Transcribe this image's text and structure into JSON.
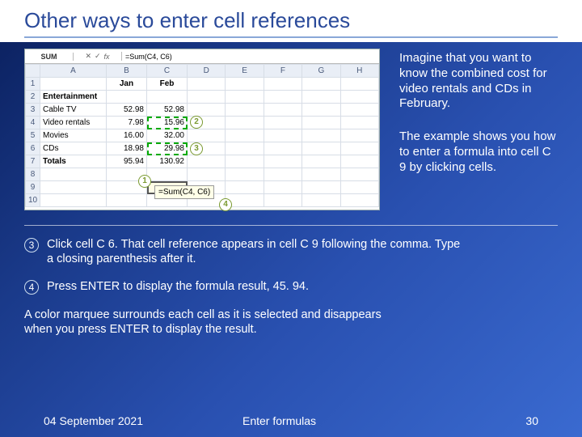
{
  "title": "Other ways to enter cell references",
  "excel": {
    "namebox": "SUM",
    "fx_icons": {
      "cancel": "✕",
      "confirm": "✓",
      "fx": "fx"
    },
    "formula": "=Sum(C4, C6)",
    "col_headers": [
      "A",
      "B",
      "C",
      "D",
      "E",
      "F",
      "G",
      "H"
    ],
    "rows": [
      {
        "n": "1",
        "a": "",
        "b": "Jan",
        "c": "Feb"
      },
      {
        "n": "2",
        "a": "Entertainment",
        "b": "",
        "c": ""
      },
      {
        "n": "3",
        "a": "Cable TV",
        "b": "52.98",
        "c": "52.98"
      },
      {
        "n": "4",
        "a": "Video rentals",
        "b": "7.98",
        "c": "15.96"
      },
      {
        "n": "5",
        "a": "Movies",
        "b": "16.00",
        "c": "32.00"
      },
      {
        "n": "6",
        "a": "CDs",
        "b": "18.98",
        "c": "29.98"
      },
      {
        "n": "7",
        "a": "Totals",
        "b": "95.94",
        "c": "130.92"
      },
      {
        "n": "8",
        "a": "",
        "b": "",
        "c": ""
      },
      {
        "n": "9",
        "a": "",
        "b": "",
        "c": ""
      },
      {
        "n": "10",
        "a": "",
        "b": "",
        "c": ""
      }
    ],
    "callout_formula": "=Sum(C4, C6)",
    "badges": {
      "b1": "1",
      "b2": "2",
      "b3": "3",
      "b4": "4"
    }
  },
  "para1": "Imagine that you want to know the combined cost for video rentals and CDs in February.",
  "para2": "The example shows you how to enter a formula into cell C 9 by clicking cells.",
  "step3_num": "3",
  "step3_text": "Click cell C 6. That cell reference appears in cell C 9 following the comma. Type a closing parenthesis after it.",
  "step4_num": "4",
  "step4_text": "Press ENTER to display the formula result, 45. 94.",
  "marquee_note": "A color marquee surrounds each cell as it is selected and disappears when you press ENTER to display the result.",
  "footer": {
    "date": "04 September 2021",
    "center": "Enter formulas",
    "page": "30"
  }
}
